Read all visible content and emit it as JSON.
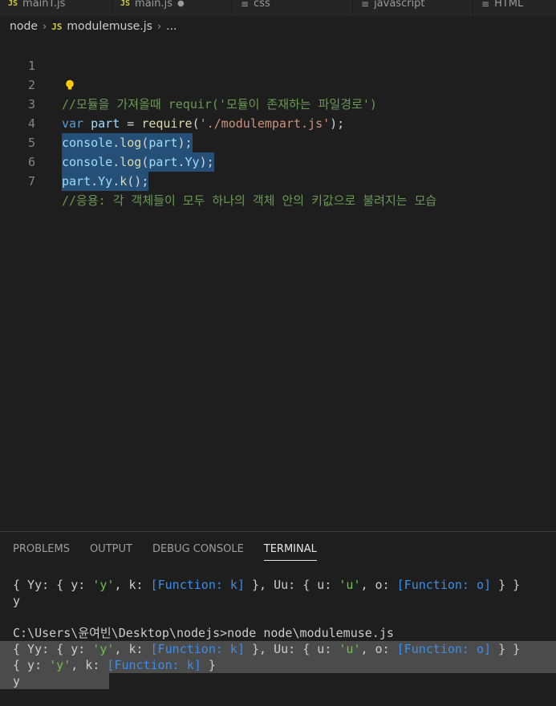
{
  "tabs": [
    {
      "label": "mainT.js",
      "icon": "js-file-icon"
    },
    {
      "label": "main.js",
      "icon": "js-file-icon",
      "dirty": true
    },
    {
      "label": "css",
      "icon": "text-file-icon"
    },
    {
      "label": "javascript",
      "icon": "text-file-icon"
    },
    {
      "label": "HTML",
      "icon": "text-file-icon"
    }
  ],
  "breadcrumb": {
    "folder": "node",
    "file_icon_text": "JS",
    "file": "modulemuse.js",
    "more": "..."
  },
  "editor": {
    "lines": [
      {
        "n": "1",
        "code": ""
      },
      {
        "n": "2",
        "code": "//모듈을 가져올때 requir('모듈이 존재하는 파일경로')"
      },
      {
        "n": "3",
        "code": "var part = require('./modulempart.js');"
      },
      {
        "n": "4",
        "code": "console.log(part);"
      },
      {
        "n": "5",
        "code": "console.log(part.Yy);"
      },
      {
        "n": "6",
        "code": "part.Yy.k();"
      },
      {
        "n": "7",
        "code": "//응용: 각 객체들이 모두 하나의 객체 안의 키값으로 불려지는 모습"
      }
    ],
    "colors": {
      "comment": "#6a9955",
      "keyword": "#569cd6",
      "variable": "#9cdcfe",
      "function": "#dcdcaa",
      "string": "#ce9178",
      "selection": "#264f78"
    }
  },
  "panel": {
    "tabs": [
      "PROBLEMS",
      "OUTPUT",
      "DEBUG CONSOLE",
      "TERMINAL"
    ],
    "active_tab": "TERMINAL",
    "terminal_lines": [
      "{ Yy: { y: 'y', k: [Function: k] }, Uu: { u: 'u', o: [Function: o] } }",
      "y",
      "",
      "C:\\Users\\윤여빈\\Desktop\\nodejs>node node\\modulemuse.js",
      "{ Yy: { y: 'y', k: [Function: k] }, Uu: { u: 'u', o: [Function: o] } }",
      "{ y: 'y', k: [Function: k] }",
      "y"
    ]
  }
}
